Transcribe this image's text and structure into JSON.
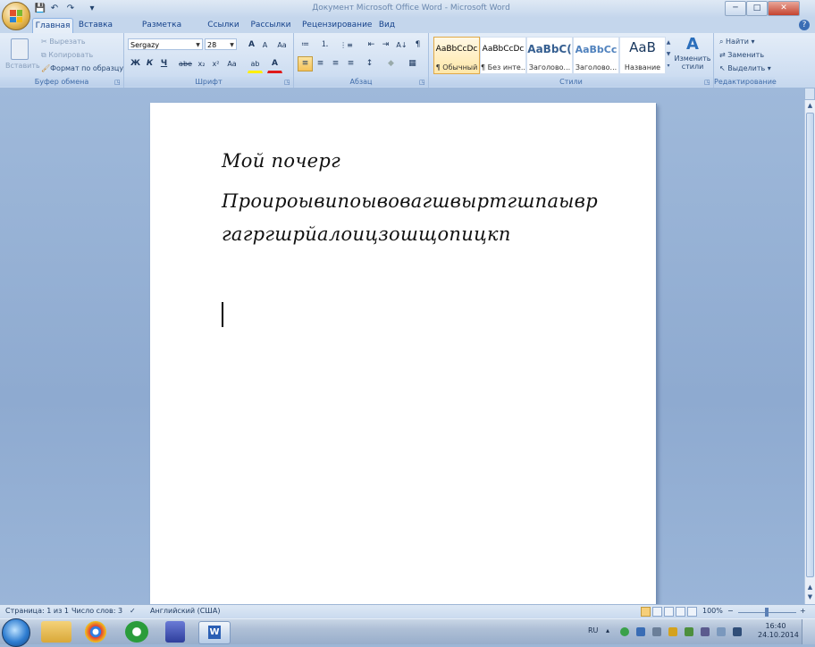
{
  "window": {
    "title": "Документ Microsoft Office Word - Microsoft Word",
    "controls": {
      "minimize": "─",
      "maximize": "□",
      "close": "✕"
    }
  },
  "qat": {
    "save": "💾",
    "undo": "↶",
    "redo": "↷",
    "customize": "▾"
  },
  "tabs": [
    {
      "label": "Главная",
      "active": true
    },
    {
      "label": "Вставка"
    },
    {
      "label": "Разметка страницы"
    },
    {
      "label": "Ссылки"
    },
    {
      "label": "Рассылки"
    },
    {
      "label": "Рецензирование"
    },
    {
      "label": "Вид"
    }
  ],
  "help": "?",
  "ribbon": {
    "clipboard": {
      "group_label": "Буфер обмена",
      "paste": "Вставить",
      "cut": "Вырезать",
      "copy": "Копировать",
      "format_painter": "Формат по образцу"
    },
    "font": {
      "group_label": "Шрифт",
      "font_name": "Sergazy",
      "font_size": "28",
      "grow": "A",
      "shrink": "A",
      "clear": "Aa",
      "bold": "Ж",
      "italic": "К",
      "underline": "Ч",
      "strike": "abe",
      "subscript": "x₂",
      "superscript": "x²",
      "change_case": "Aa",
      "highlight": "ab",
      "font_color": "A"
    },
    "paragraph": {
      "group_label": "Абзац",
      "bullets": "≔",
      "numbering": "⒈",
      "multilevel": "⋮≡",
      "decrease_indent": "⇤",
      "increase_indent": "⇥",
      "sort": "A↓",
      "show_marks": "¶",
      "align_left": "≡",
      "align_center": "≡",
      "align_right": "≡",
      "justify": "≡",
      "line_spacing": "↕",
      "shading": "◆",
      "borders": "▦"
    },
    "styles": {
      "group_label": "Стили",
      "items": [
        {
          "sample": "AaBbCcDc",
          "name": "¶ Обычный",
          "active": true
        },
        {
          "sample": "AaBbCcDc",
          "name": "¶ Без инте..."
        },
        {
          "sample": "AaBbC(",
          "name": "Заголово..."
        },
        {
          "sample": "AaBbCc",
          "name": "Заголово..."
        },
        {
          "sample": "AaB",
          "name": "Название"
        }
      ],
      "change_styles": "Изменить стили"
    },
    "editing": {
      "group_label": "Редактирование",
      "find": "Найти",
      "replace": "Заменить",
      "select": "Выделить"
    }
  },
  "document": {
    "lines": [
      "Мой почерг",
      "Проироывипоывовагшвыртгшпаывр",
      "гагргшрйалоицзошщопицкп"
    ]
  },
  "statusbar": {
    "page": "Страница: 1 из 1",
    "words": "Число слов: 3",
    "language": "Английский (США)",
    "zoom": "100%",
    "zoom_minus": "−",
    "zoom_plus": "+"
  },
  "taskbar": {
    "lang": "RU",
    "time": "16:40",
    "date": "24.10.2014"
  },
  "colors": {
    "ribbon_bg": "#d0dff2",
    "workspace_bg": "#9fb9da",
    "accent": "#15428b"
  }
}
